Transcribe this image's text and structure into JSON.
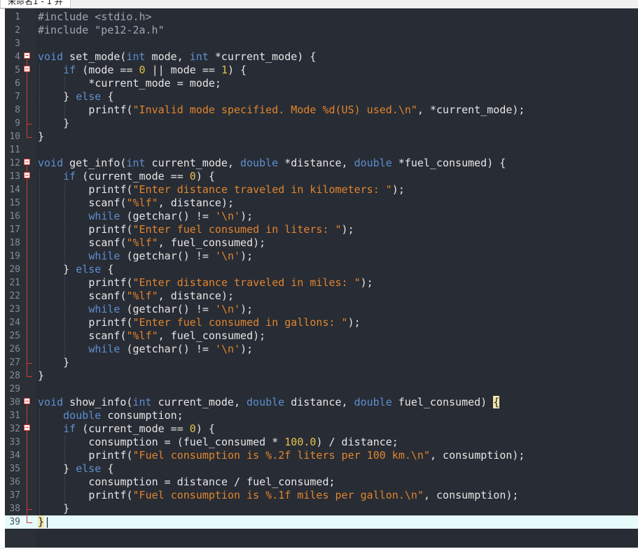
{
  "tab": {
    "title": "未命名1 - 1 并"
  },
  "editor": {
    "current_line": 39,
    "lines": [
      {
        "n": "1",
        "fold": "",
        "indent": 0,
        "html": "<span class=\"pp\">#include &lt;stdio.h&gt;</span>"
      },
      {
        "n": "2",
        "fold": "",
        "indent": 0,
        "html": "<span class=\"pp\">#include \"pe12-2a.h\"</span>"
      },
      {
        "n": "3",
        "fold": "",
        "indent": 0,
        "html": ""
      },
      {
        "n": "4",
        "fold": "open",
        "indent": 0,
        "html": "<span class=\"kw\">void</span> set_mode(<span class=\"kw\">int</span> mode, <span class=\"kw\">int</span> *current_mode) {"
      },
      {
        "n": "5",
        "fold": "open",
        "indent": 1,
        "html": "<span class=\"kw\">if</span> (mode == <span class=\"num\">0</span> || mode == <span class=\"num\">1</span>) {"
      },
      {
        "n": "6",
        "fold": "",
        "indent": 2,
        "html": "*current_mode = mode;"
      },
      {
        "n": "7",
        "fold": "",
        "indent": 1,
        "html": "} <span class=\"kw\">else</span> {"
      },
      {
        "n": "8",
        "fold": "",
        "indent": 2,
        "html": "printf(<span class=\"str\">\"Invalid mode specified. Mode %d(US) used.\\n\"</span>, *current_mode);"
      },
      {
        "n": "9",
        "fold": "end",
        "indent": 1,
        "html": "}"
      },
      {
        "n": "10",
        "fold": "end",
        "indent": 0,
        "html": "}"
      },
      {
        "n": "11",
        "fold": "",
        "indent": 0,
        "html": ""
      },
      {
        "n": "12",
        "fold": "open",
        "indent": 0,
        "html": "<span class=\"kw\">void</span> get_info(<span class=\"kw\">int</span> current_mode, <span class=\"kw\">double</span> *distance, <span class=\"kw\">double</span> *fuel_consumed) {"
      },
      {
        "n": "13",
        "fold": "open",
        "indent": 1,
        "html": "<span class=\"kw\">if</span> (current_mode == <span class=\"num\">0</span>) {"
      },
      {
        "n": "14",
        "fold": "",
        "indent": 2,
        "html": "printf(<span class=\"str\">\"Enter distance traveled in kilometers: \"</span>);"
      },
      {
        "n": "15",
        "fold": "",
        "indent": 2,
        "html": "scanf(<span class=\"str\">\"%lf\"</span>, distance);"
      },
      {
        "n": "16",
        "fold": "",
        "indent": 2,
        "html": "<span class=\"kw\">while</span> (getchar() != <span class=\"str\">'\\n'</span>);"
      },
      {
        "n": "17",
        "fold": "",
        "indent": 2,
        "html": "printf(<span class=\"str\">\"Enter fuel consumed in liters: \"</span>);"
      },
      {
        "n": "18",
        "fold": "",
        "indent": 2,
        "html": "scanf(<span class=\"str\">\"%lf\"</span>, fuel_consumed);"
      },
      {
        "n": "19",
        "fold": "",
        "indent": 2,
        "html": "<span class=\"kw\">while</span> (getchar() != <span class=\"str\">'\\n'</span>);"
      },
      {
        "n": "20",
        "fold": "",
        "indent": 1,
        "html": "} <span class=\"kw\">else</span> {"
      },
      {
        "n": "21",
        "fold": "",
        "indent": 2,
        "html": "printf(<span class=\"str\">\"Enter distance traveled in miles: \"</span>);"
      },
      {
        "n": "22",
        "fold": "",
        "indent": 2,
        "html": "scanf(<span class=\"str\">\"%lf\"</span>, distance);"
      },
      {
        "n": "23",
        "fold": "",
        "indent": 2,
        "html": "<span class=\"kw\">while</span> (getchar() != <span class=\"str\">'\\n'</span>);"
      },
      {
        "n": "24",
        "fold": "",
        "indent": 2,
        "html": "printf(<span class=\"str\">\"Enter fuel consumed in gallons: \"</span>);"
      },
      {
        "n": "25",
        "fold": "",
        "indent": 2,
        "html": "scanf(<span class=\"str\">\"%lf\"</span>, fuel_consumed);"
      },
      {
        "n": "26",
        "fold": "",
        "indent": 2,
        "html": "<span class=\"kw\">while</span> (getchar() != <span class=\"str\">'\\n'</span>);"
      },
      {
        "n": "27",
        "fold": "end",
        "indent": 1,
        "html": "}"
      },
      {
        "n": "28",
        "fold": "end",
        "indent": 0,
        "html": "}"
      },
      {
        "n": "29",
        "fold": "",
        "indent": 0,
        "html": ""
      },
      {
        "n": "30",
        "fold": "open",
        "indent": 0,
        "html": "<span class=\"kw\">void</span> show_info(<span class=\"kw\">int</span> current_mode, <span class=\"kw\">double</span> distance, <span class=\"kw\">double</span> fuel_consumed) <span class=\"brace-hl\">{</span>"
      },
      {
        "n": "31",
        "fold": "",
        "indent": 1,
        "html": "<span class=\"kw\">double</span> consumption;"
      },
      {
        "n": "32",
        "fold": "open",
        "indent": 1,
        "html": "<span class=\"kw\">if</span> (current_mode == <span class=\"num\">0</span>) {"
      },
      {
        "n": "33",
        "fold": "",
        "indent": 2,
        "html": "consumption = (fuel_consumed * <span class=\"num\">100.0</span>) / distance;"
      },
      {
        "n": "34",
        "fold": "",
        "indent": 2,
        "html": "printf(<span class=\"str\">\"Fuel consumption is %.2f liters per 100 km.\\n\"</span>, consumption);"
      },
      {
        "n": "35",
        "fold": "",
        "indent": 1,
        "html": "} <span class=\"kw\">else</span> {"
      },
      {
        "n": "36",
        "fold": "",
        "indent": 2,
        "html": "consumption = distance / fuel_consumed;"
      },
      {
        "n": "37",
        "fold": "",
        "indent": 2,
        "html": "printf(<span class=\"str\">\"Fuel consumption is %.1f miles per gallon.\\n\"</span>, consumption);"
      },
      {
        "n": "38",
        "fold": "end",
        "indent": 1,
        "html": "}"
      },
      {
        "n": "39",
        "fold": "end",
        "indent": 0,
        "html": "<span class=\"brace-hl\">}</span><span class=\"caret\">|</span>"
      }
    ]
  }
}
